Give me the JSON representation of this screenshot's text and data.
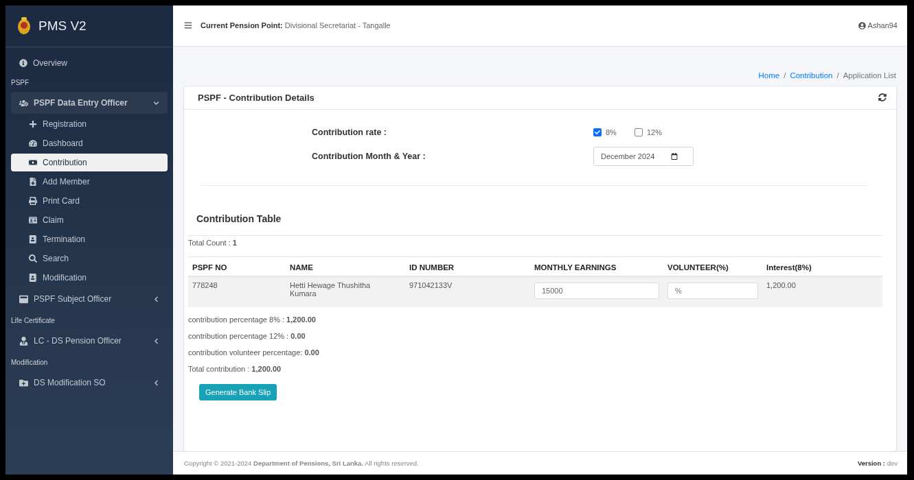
{
  "brand": {
    "title": "PMS V2"
  },
  "sidebar": [
    {
      "kind": "link",
      "label": "Overview"
    },
    {
      "kind": "header",
      "label": "PSPF"
    },
    {
      "kind": "group",
      "label": "PSPF Data Entry Officer",
      "expanded": true,
      "children": [
        {
          "label": "Registration",
          "selected": false
        },
        {
          "label": "Dashboard",
          "selected": false
        },
        {
          "label": "Contribution",
          "selected": true
        },
        {
          "label": "Add Member",
          "selected": false
        },
        {
          "label": "Print Card",
          "selected": false
        },
        {
          "label": "Claim",
          "selected": false
        },
        {
          "label": "Termination",
          "selected": false
        },
        {
          "label": "Search",
          "selected": false
        },
        {
          "label": "Modification",
          "selected": false
        }
      ]
    },
    {
      "kind": "group",
      "label": "PSPF Subject Officer",
      "expanded": false
    },
    {
      "kind": "header",
      "label": "Life Certificate"
    },
    {
      "kind": "group",
      "label": "LC - DS Pension Officer",
      "expanded": false
    },
    {
      "kind": "header",
      "label": "Modification"
    },
    {
      "kind": "group",
      "label": "DS Modification SO",
      "expanded": false
    }
  ],
  "topbar": {
    "pension_point_label": "Current Pension Point:",
    "pension_point": "Divisional Secretariat - Tangalle",
    "user": "Ashan94"
  },
  "breadcrumb": [
    {
      "label": "Home",
      "link": true
    },
    {
      "separator": "/",
      "label": "Contribution",
      "link": true
    },
    {
      "separator": "/",
      "label": "Application List",
      "link": false
    }
  ],
  "card": {
    "title": "PSPF - Contribution Details",
    "rate_label": "Contribution rate :",
    "rates": [
      {
        "label": "8%",
        "checked": true
      },
      {
        "label": "12%",
        "checked": false
      }
    ],
    "month_label": "Contribution Month & Year :",
    "month_value": "December 2024",
    "table_title": "Contribution Table",
    "total_count": "Total Count : **1**",
    "columns": [
      "PSPF NO",
      "NAME",
      "ID NUMBER",
      "MONTHLY EARNINGS",
      "VOLUNTEER(%)",
      "Interest(8%)"
    ],
    "rows": [
      {
        "pspf_no": "778248",
        "name": "Hetti Hewage Thushitha Kumara",
        "id_number": "971042133V",
        "monthly_earnings": "15000",
        "volunteer_placeholder": "%",
        "interest": "1,200.00"
      }
    ],
    "summary": [
      "contribution percentage 8% : **1,200.00**",
      "contribution percentage 12% : **0.00**",
      "contribution volunteer percentage: **0.00**",
      "Total contribution : **1,200.00**"
    ],
    "button": "Generate Bank Slip"
  },
  "footer": {
    "copyright": "Copyright © 2021-2024 **Department of Pensions, Sri Lanka.** All rights reserved.",
    "version_label": "Version :",
    "version": "dev"
  }
}
